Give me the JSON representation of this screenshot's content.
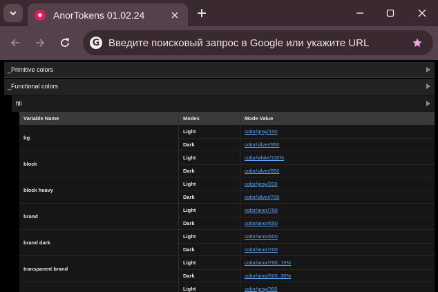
{
  "browser": {
    "tab_title": "AnorTokens 01.02.24",
    "address_placeholder": "Введите поисковый запрос в Google или укажите URL",
    "icons": {
      "tab_search": "chevron-down-icon",
      "new_tab": "plus-icon",
      "minimize": "minimize-icon",
      "maximize": "maximize-icon",
      "close": "close-icon",
      "back": "back-arrow-icon",
      "forward": "forward-arrow-icon",
      "reload": "reload-icon",
      "bookmark": "star-icon"
    },
    "accent_star": "#f4a6e0",
    "favicon_color": "#e21a55"
  },
  "sections": [
    {
      "label": "_Primitive colors"
    },
    {
      "label": "_Functional colors"
    }
  ],
  "subsection": {
    "label": "fill"
  },
  "table": {
    "headers": [
      "Variable Name",
      "Modes",
      "Mode Value"
    ],
    "groups": [
      {
        "name": "bg",
        "rows": [
          {
            "mode": "Light",
            "value": "color/gray/150"
          },
          {
            "mode": "Dark",
            "value": "color/silver/950"
          }
        ]
      },
      {
        "name": "block",
        "rows": [
          {
            "mode": "Light",
            "value": "color/white/100%"
          },
          {
            "mode": "Dark",
            "value": "color/silver/850"
          }
        ]
      },
      {
        "name": "block heavy",
        "rows": [
          {
            "mode": "Light",
            "value": "color/gray/200"
          },
          {
            "mode": "Dark",
            "value": "color/silver/700"
          }
        ]
      },
      {
        "name": "brand",
        "rows": [
          {
            "mode": "Light",
            "value": "color/anor/700"
          },
          {
            "mode": "Dark",
            "value": "color/anor/650"
          }
        ]
      },
      {
        "name": "brand dark",
        "rows": [
          {
            "mode": "Light",
            "value": "color/anor/800"
          },
          {
            "mode": "Dark",
            "value": "color/anor/700"
          }
        ]
      },
      {
        "name": "transparent brand",
        "rows": [
          {
            "mode": "Light",
            "value": "color/anor/700, 15%"
          },
          {
            "mode": "Dark",
            "value": "color/anor/500, 30%"
          }
        ]
      },
      {
        "name": "",
        "rows": [
          {
            "mode": "Light",
            "value": "color/gray/300"
          }
        ]
      }
    ]
  }
}
